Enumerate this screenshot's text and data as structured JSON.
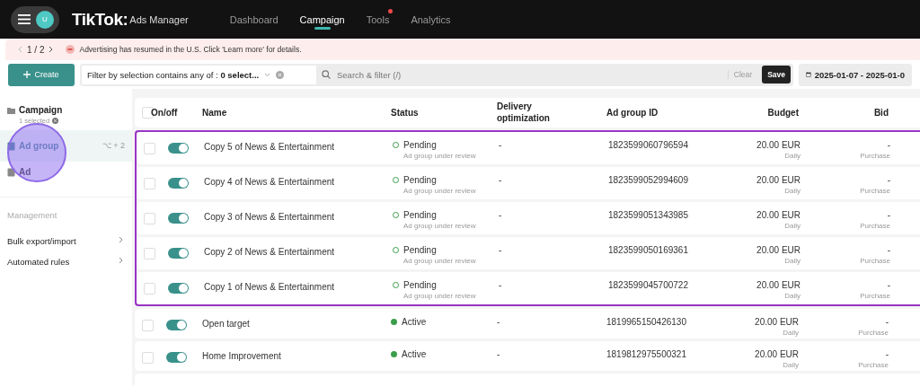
{
  "header": {
    "avatar": "U",
    "logo": "TikTok:",
    "product": "Ads Manager",
    "nav": [
      {
        "label": "Dashboard",
        "selected": false,
        "dot": false
      },
      {
        "label": "Campaign",
        "selected": true,
        "dot": false
      },
      {
        "label": "Tools",
        "selected": false,
        "dot": true
      },
      {
        "label": "Analytics",
        "selected": false,
        "dot": false
      }
    ]
  },
  "banner": {
    "pager": "1 / 2",
    "message": "Advertising has resumed in the U.S. Click 'Learn more' for details."
  },
  "toolbar": {
    "create": "Create",
    "filter": "Filter by selection contains any of : ",
    "filter_value": "0 select...",
    "search_placeholder": "Search & filter (/)",
    "clear": "Clear",
    "save": "Save",
    "date_range": "2025-01-07 - 2025-01-0"
  },
  "sidebar": {
    "levels": [
      {
        "kind": "campaign",
        "label": "Campaign",
        "note": "1 selected",
        "selected": false
      },
      {
        "kind": "adgroup",
        "label": "Ad group",
        "shortcut": "⌥ + 2",
        "selected": true
      },
      {
        "kind": "ad",
        "label": "Ad",
        "selected": false
      }
    ],
    "section": "Management",
    "links": [
      "Bulk export/import",
      "Automated rules"
    ]
  },
  "table": {
    "all_checked": false,
    "columns": [
      "On/off",
      "Name",
      "Status",
      "Delivery optimization",
      "Ad group ID",
      "Budget",
      "Bid"
    ],
    "highlighted_rows": [
      {
        "checked": false,
        "on": true,
        "name": "Copy 5 of News & Entertainment",
        "status": "Pending",
        "kind": "pending",
        "status_note": "Ad group under review",
        "delivery": "-",
        "id": "1823599060796594",
        "budget": "20.00 EUR",
        "budget_type": "Daily",
        "bid": "-",
        "bid_type": "Purchase"
      },
      {
        "checked": false,
        "on": true,
        "name": "Copy 4 of News & Entertainment",
        "status": "Pending",
        "kind": "pending",
        "status_note": "Ad group under review",
        "delivery": "-",
        "id": "1823599052994609",
        "budget": "20.00 EUR",
        "budget_type": "Daily",
        "bid": "-",
        "bid_type": "Purchase"
      },
      {
        "checked": false,
        "on": true,
        "name": "Copy 3 of News & Entertainment",
        "status": "Pending",
        "kind": "pending",
        "status_note": "Ad group under review",
        "delivery": "-",
        "id": "1823599051343985",
        "budget": "20.00 EUR",
        "budget_type": "Daily",
        "bid": "-",
        "bid_type": "Purchase"
      },
      {
        "checked": false,
        "on": true,
        "name": "Copy 2 of News & Entertainment",
        "status": "Pending",
        "kind": "pending",
        "status_note": "Ad group under review",
        "delivery": "-",
        "id": "1823599050169361",
        "budget": "20.00 EUR",
        "budget_type": "Daily",
        "bid": "-",
        "bid_type": "Purchase"
      },
      {
        "checked": false,
        "on": true,
        "name": "Copy 1 of News & Entertainment",
        "status": "Pending",
        "kind": "pending",
        "status_note": "Ad group under review",
        "delivery": "-",
        "id": "1823599045700722",
        "budget": "20.00 EUR",
        "budget_type": "Daily",
        "bid": "-",
        "bid_type": "Purchase"
      }
    ],
    "rows": [
      {
        "checked": false,
        "on": true,
        "name": "Open target",
        "status": "Active",
        "kind": "active",
        "delivery": "-",
        "id": "1819965150426130",
        "budget": "20.00 EUR",
        "budget_type": "Daily",
        "bid": "-",
        "bid_type": "Purchase"
      },
      {
        "checked": false,
        "on": true,
        "name": "Home Improvement",
        "status": "Active",
        "kind": "active",
        "delivery": "-",
        "id": "1819812975500321",
        "budget": "20.00 EUR",
        "budget_type": "Daily",
        "bid": "-",
        "bid_type": "Purchase"
      }
    ]
  }
}
